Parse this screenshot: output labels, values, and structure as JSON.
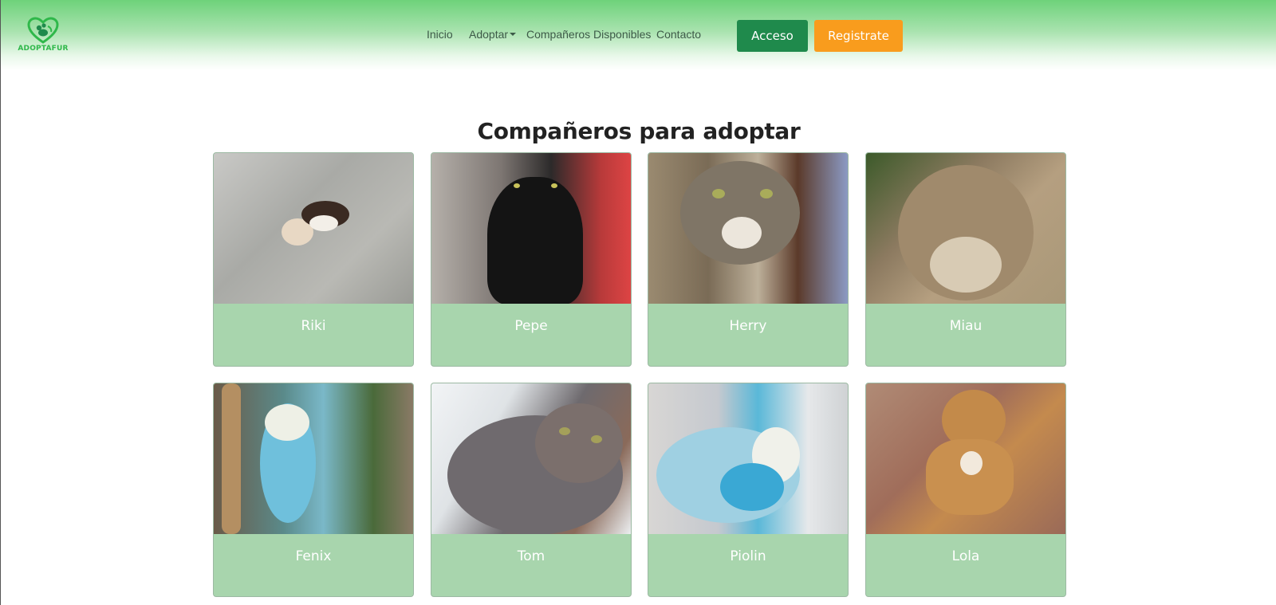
{
  "brand": {
    "name": "ADOPTAFUR"
  },
  "nav": {
    "items": [
      {
        "label": "Inicio"
      },
      {
        "label": "Adoptar"
      },
      {
        "label": "Compañeros Disponibles"
      },
      {
        "label": "Contacto"
      }
    ]
  },
  "auth": {
    "login_label": "Acceso",
    "register_label": "Registrate"
  },
  "page": {
    "title": "Compañeros para adoptar"
  },
  "pets": [
    {
      "name": "Riki",
      "photo": "beagle-dog-photo"
    },
    {
      "name": "Pepe",
      "photo": "black-cat-photo"
    },
    {
      "name": "Herry",
      "photo": "tabby-cat-photo"
    },
    {
      "name": "Miau",
      "photo": "long-hair-cat-photo"
    },
    {
      "name": "Fenix",
      "photo": "blue-parakeet-photo"
    },
    {
      "name": "Tom",
      "photo": "grey-cat-photo"
    },
    {
      "name": "Piolin",
      "photo": "parakeet-photo"
    },
    {
      "name": "Lola",
      "photo": "tan-dog-photo"
    }
  ],
  "colors": {
    "header_gradient_top": "#6ed27a",
    "login_button": "#1f8a4c",
    "register_button": "#f99c1d",
    "card_background": "#a8d5ad",
    "brand_green": "#2fb84a"
  }
}
